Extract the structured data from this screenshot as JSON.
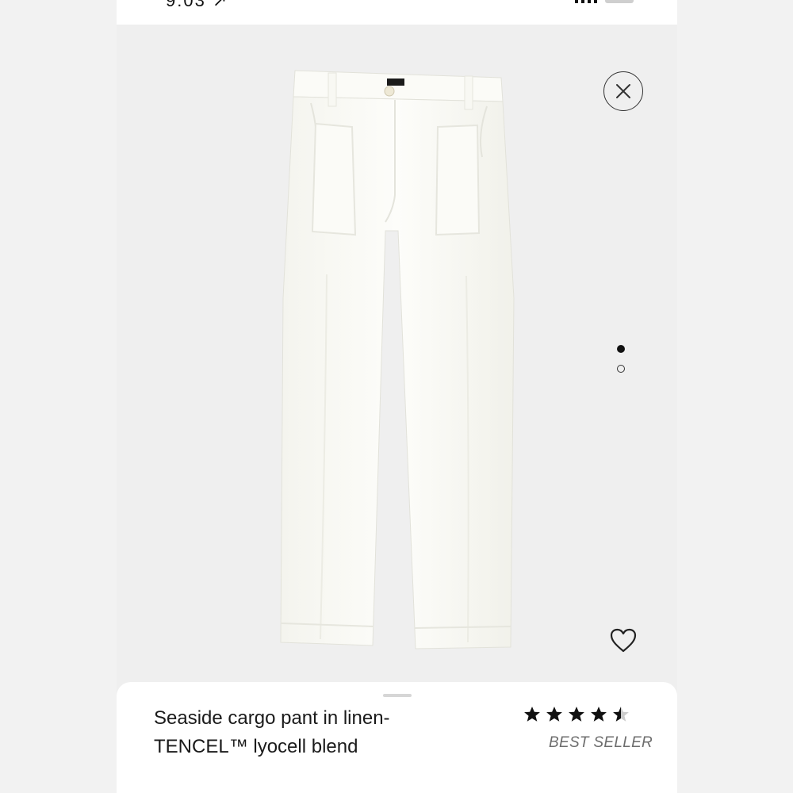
{
  "status_bar": {
    "time": "9:03 ↗"
  },
  "gallery": {
    "image_alt": "Seaside cargo pant in linen-TENCEL lyocell blend, white, flat lay",
    "page_count": 2,
    "current_page": 1
  },
  "icons": {
    "close": "close-icon",
    "wishlist": "heart-icon",
    "star": "star-icon"
  },
  "product": {
    "title": "Seaside cargo pant in linen-TENCEL™ lyocell blend",
    "rating": 4.5,
    "rating_max": 5,
    "badge": "BEST SELLER"
  },
  "colors": {
    "background": "#efefef",
    "sheet": "#ffffff",
    "text": "#1a1a1a",
    "badge_text": "#6d6d6d",
    "garment": "#fbfbf7"
  }
}
